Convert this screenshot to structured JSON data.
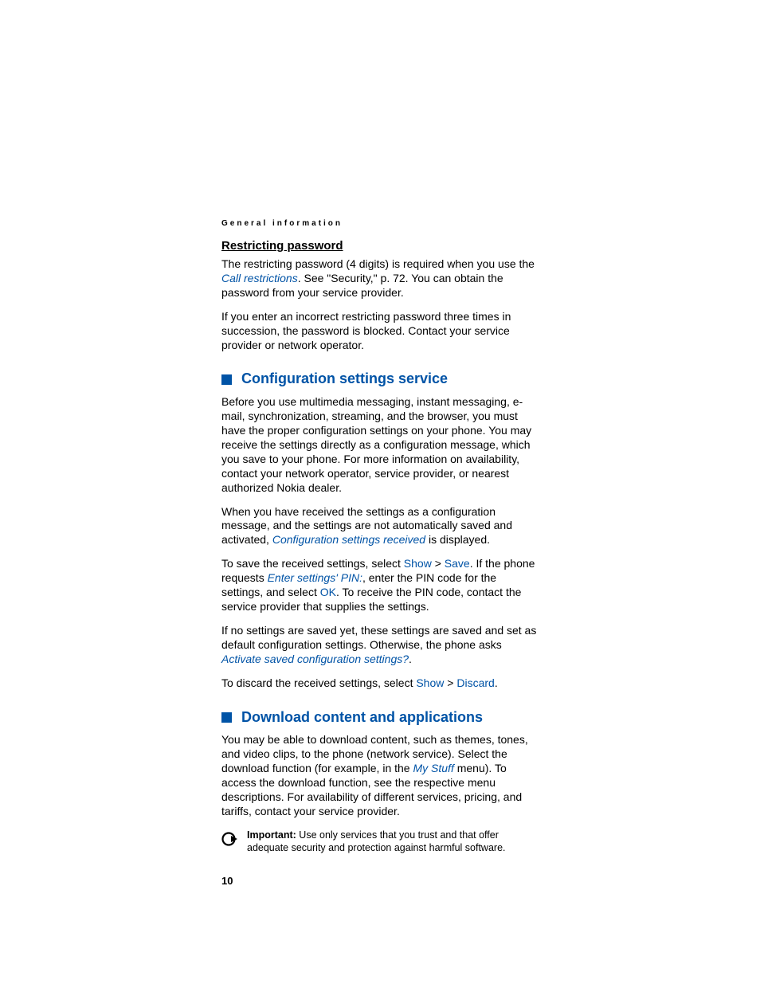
{
  "header": "General information",
  "subheading1": "Restricting password",
  "p1a": "The restricting password (4 digits) is required when you use the ",
  "p1_link": "Call restrictions",
  "p1b": ". See \"Security,\" p. 72. You can obtain the password from your service provider.",
  "p2": "If you enter an incorrect restricting password three times in succession, the password is blocked. Contact your service provider or network operator.",
  "section1_title": "Configuration settings service",
  "s1p1": "Before you use multimedia messaging, instant messaging, e-mail, synchronization, streaming, and the browser, you must have the proper configuration settings on your phone. You may receive the settings directly as a configuration message, which you save to your phone. For more information on availability, contact your network operator, service provider, or nearest authorized Nokia dealer.",
  "s1p2a": "When you have received the settings as a configuration message, and the settings are not automatically saved and activated, ",
  "s1p2_link": "Configuration settings received",
  "s1p2b": " is displayed.",
  "s1p3a": "To save the received settings, select ",
  "s1p3_show": "Show",
  "gt": " > ",
  "s1p3_save": "Save",
  "s1p3b": ". If the phone requests ",
  "s1p3_link": "Enter settings' PIN:",
  "s1p3c": ", enter the PIN code for the settings, and select ",
  "s1p3_ok": "OK",
  "s1p3d": ". To receive the PIN code, contact the service provider that supplies the settings.",
  "s1p4a": "If no settings are saved yet, these settings are saved and set as default configuration settings. Otherwise, the phone asks ",
  "s1p4_link": "Activate saved configuration settings?",
  "s1p4b": ".",
  "s1p5a": "To discard the received settings, select ",
  "s1p5_show": "Show",
  "s1p5_discard": "Discard",
  "s1p5b": ".",
  "section2_title": "Download content and applications",
  "s2p1a": "You may be able to download content, such as themes, tones, and video clips, to the phone (network service). Select the download function (for example, in the ",
  "s2p1_link": "My Stuff",
  "s2p1b": " menu). To access the download function, see the respective menu descriptions. For availability of different services, pricing, and tariffs, contact your service provider.",
  "important_label": "Important:",
  "important_text": " Use only services that you trust and that offer adequate security and protection against harmful software.",
  "page_number": "10"
}
